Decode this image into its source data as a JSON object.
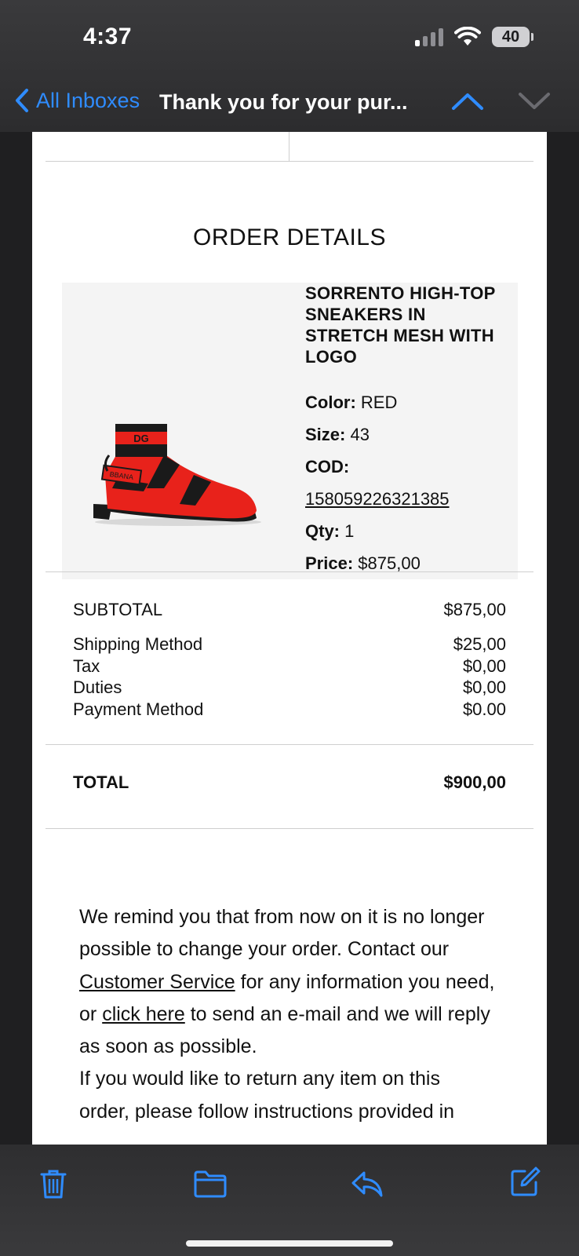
{
  "status_bar": {
    "time": "4:37",
    "battery": "40"
  },
  "nav": {
    "back_label": "All Inboxes",
    "subject": "Thank you for your pur..."
  },
  "email": {
    "order_title": "ORDER DETAILS",
    "product": {
      "name": "SORRENTO HIGH-TOP SNEAKERS IN STRETCH MESH WITH LOGO",
      "color_label": "Color:",
      "color": "RED",
      "size_label": "Size:",
      "size": "43",
      "cod_label": "COD:",
      "cod": "158059226321385",
      "qty_label": "Qty:",
      "qty": "1",
      "price_label": "Price:",
      "price": "$875,00",
      "image_text_top": "DG",
      "image_text_side": "BBANA"
    },
    "summary": {
      "subtotal_label": "SUBTOTAL",
      "subtotal": "$875,00",
      "shipping_label": "Shipping Method",
      "shipping": "$25,00",
      "tax_label": "Tax",
      "tax": "$0,00",
      "duties_label": "Duties",
      "duties": "$0,00",
      "payment_label": "Payment Method",
      "payment": "$0.00",
      "total_label": "TOTAL",
      "total": "$900,00"
    },
    "reminder": {
      "p1": "We remind you that from now on it is no longer possible to change your order. Contact our ",
      "link1": "Customer Service",
      "p2": " for any information you need, or ",
      "link2": "click here",
      "p3": " to send an e-mail and we will reply as soon as possible.",
      "p4": "If you would like to return any item on this order, please follow instructions provided in"
    }
  },
  "colors": {
    "accent": "#2f8cff",
    "shoe_red": "#e8221b",
    "shoe_black": "#1a1a1a"
  }
}
